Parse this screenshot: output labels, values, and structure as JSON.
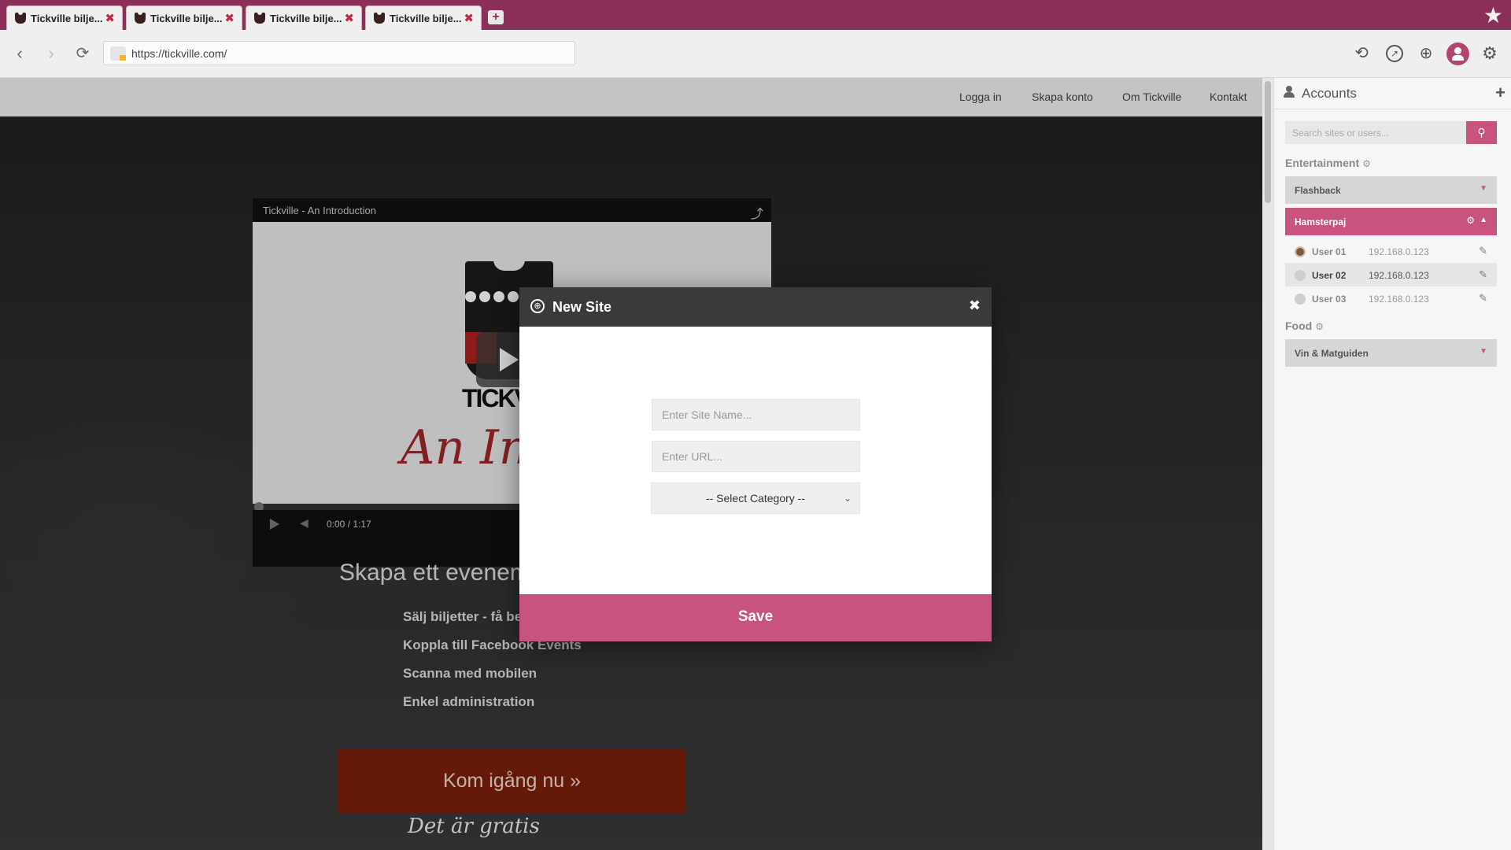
{
  "browser": {
    "tabs": [
      {
        "label": "Tickville bilje..."
      },
      {
        "label": "Tickville bilje..."
      },
      {
        "label": "Tickville bilje..."
      },
      {
        "label": "Tickville bilje..."
      }
    ],
    "new_tab_label": "+",
    "url": "https://tickville.com/"
  },
  "site": {
    "nav": [
      "Logga in",
      "Skapa konto",
      "Om Tickville",
      "Kontakt"
    ],
    "video": {
      "title": "Tickville - An Introduction",
      "logo_text": "TICKV",
      "script_text": "An Intr",
      "time": "0:00 / 1:17"
    },
    "heading": "Skapa ett evenema",
    "features": [
      "Sälj biljetter - få bet",
      "Koppla till Facebook Events",
      "Scanna med mobilen",
      "Enkel administration"
    ],
    "cta_label": "Kom igång nu »",
    "free_text": "Det är gratis"
  },
  "modal": {
    "title": "New Site",
    "site_name_placeholder": "Enter Site Name...",
    "url_placeholder": "Enter URL...",
    "category_selected": "-- Select Category --",
    "save_label": "Save"
  },
  "accounts": {
    "title": "Accounts",
    "search_placeholder": "Search sites or users...",
    "groups": [
      {
        "label": "Entertainment",
        "sites": [
          {
            "name": "Flashback",
            "expanded": false
          },
          {
            "name": "Hamsterpaj",
            "expanded": true,
            "users": [
              {
                "name": "User 01",
                "ip": "192.168.0.123"
              },
              {
                "name": "User 02",
                "ip": "192.168.0.123",
                "selected": true
              },
              {
                "name": "User 03",
                "ip": "192.168.0.123"
              }
            ]
          }
        ]
      },
      {
        "label": "Food",
        "sites": [
          {
            "name": "Vin & Matguiden",
            "expanded": false
          }
        ]
      }
    ]
  },
  "colors": {
    "accent": "#c8537e",
    "tabbar": "#8a2f57",
    "cta": "#7a1f0c"
  }
}
